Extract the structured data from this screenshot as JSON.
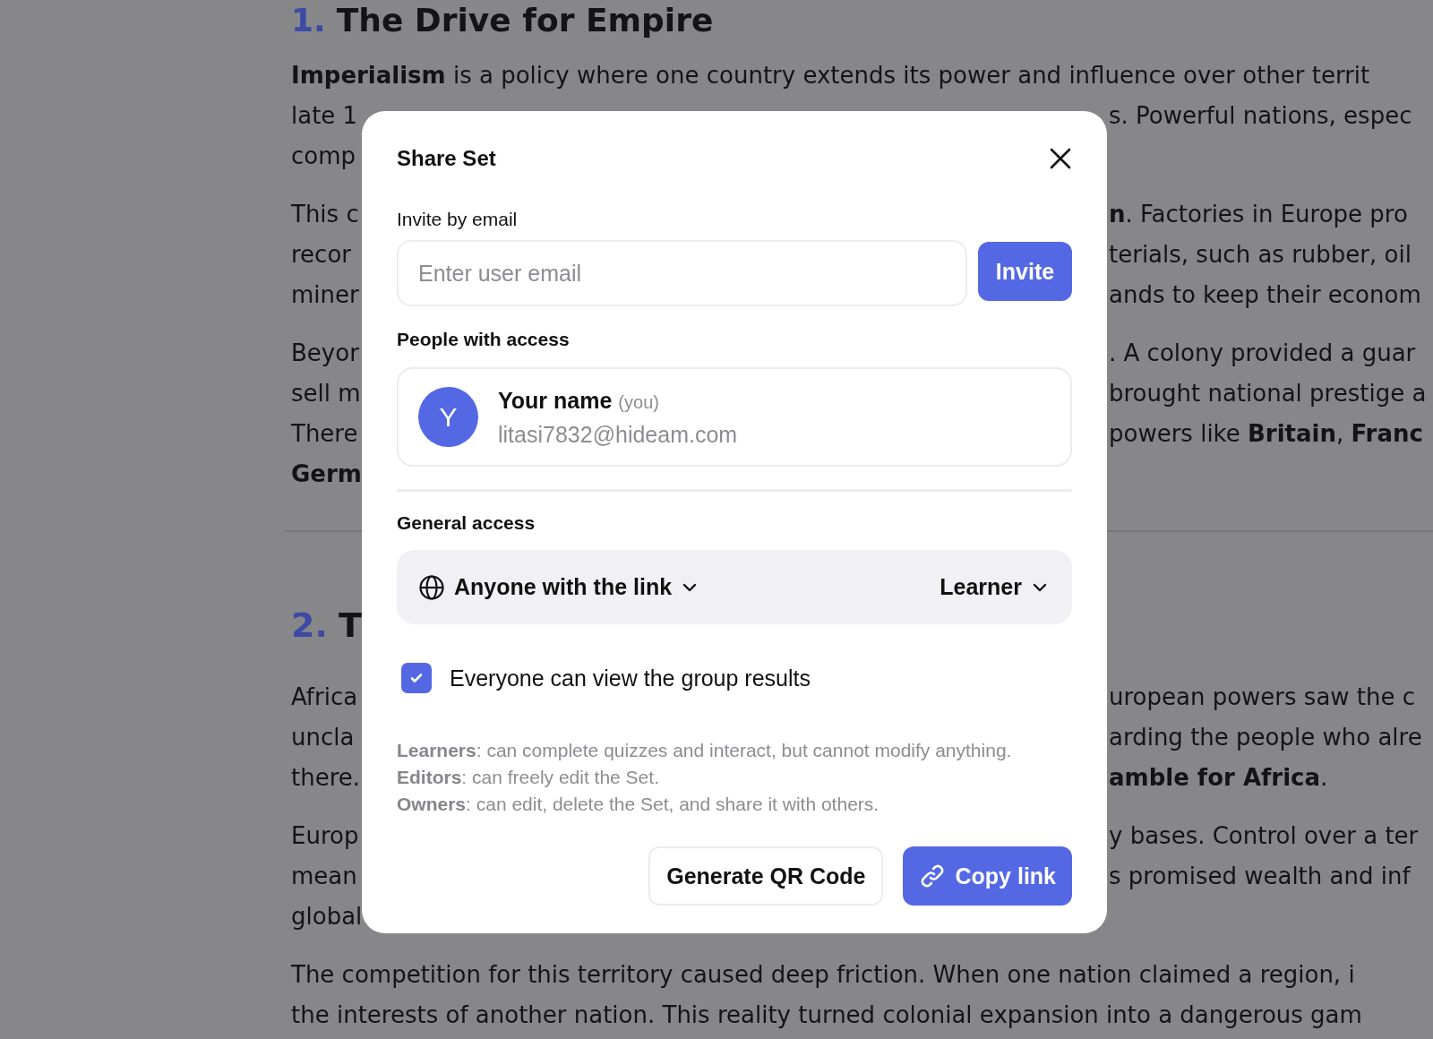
{
  "document": {
    "blocks": [
      {
        "kind": "heading",
        "number": "1.",
        "text": "The Drive for Empire"
      },
      {
        "kind": "paragraph",
        "lines": [
          {
            "left": "**Imperialism** is a policy where one country extends its power and influence over other territ"
          },
          {
            "left": "late 1",
            "right": "s. Powerful nations, espec"
          },
          {
            "left": "comp"
          }
        ]
      },
      {
        "kind": "paragraph",
        "lines": [
          {
            "left": "This c",
            "right": "**n**. Factories in Europe pro"
          },
          {
            "left": "recor",
            "right": "terials, such as rubber, oil"
          },
          {
            "left": "miner",
            "right": "ands to keep their econom"
          }
        ]
      },
      {
        "kind": "paragraph",
        "lines": [
          {
            "left": "Beyor",
            "right": ". A colony provided a guar"
          },
          {
            "left": "sell m",
            "right": "brought national prestige a"
          },
          {
            "left": "There",
            "right": "powers like **Britain**, **Franc**"
          },
          {
            "left": "**Germ**"
          }
        ]
      },
      {
        "kind": "divider"
      },
      {
        "kind": "heading",
        "number": "2.",
        "text": "T"
      },
      {
        "kind": "paragraph",
        "lines": [
          {
            "left": "Africa",
            "right": "uropean powers saw the c"
          },
          {
            "left": "uncla",
            "right": "arding the people who alre"
          },
          {
            "left": "there.",
            "right": "**amble for Africa**."
          }
        ]
      },
      {
        "kind": "paragraph",
        "lines": [
          {
            "left": "Europ",
            "right": "y bases. Control over a ter"
          },
          {
            "left": "mean",
            "right": "s promised wealth and inf"
          },
          {
            "left": "global"
          }
        ]
      },
      {
        "kind": "paragraph",
        "lines": [
          {
            "left": "The competition for this territory caused deep friction. When one nation claimed a region, i"
          },
          {
            "left": "the interests of another nation. This reality turned colonial expansion into a dangerous gam"
          }
        ]
      }
    ]
  },
  "modal": {
    "title": "Share Set",
    "invite": {
      "label": "Invite by email",
      "placeholder": "Enter user email",
      "button": "Invite"
    },
    "people": {
      "label": "People with access",
      "members": [
        {
          "initial": "Y",
          "name": "Your name",
          "note": "(you)",
          "email": "litasi7832@hideam.com"
        }
      ]
    },
    "general_access": {
      "label": "General access",
      "scope": "Anyone with the link",
      "role": "Learner"
    },
    "option": {
      "label": "Everyone can view the group results",
      "checked": true
    },
    "roles": [
      "**Learners**: can complete quizzes and interact, but cannot modify anything.",
      "**Editors**: can freely edit the Set.",
      "**Owners**: can edit, delete the Set, and share it with others."
    ],
    "buttons": [
      {
        "label": "Generate QR Code",
        "kind": "secondary"
      },
      {
        "label": "Copy link",
        "kind": "primary"
      }
    ]
  }
}
